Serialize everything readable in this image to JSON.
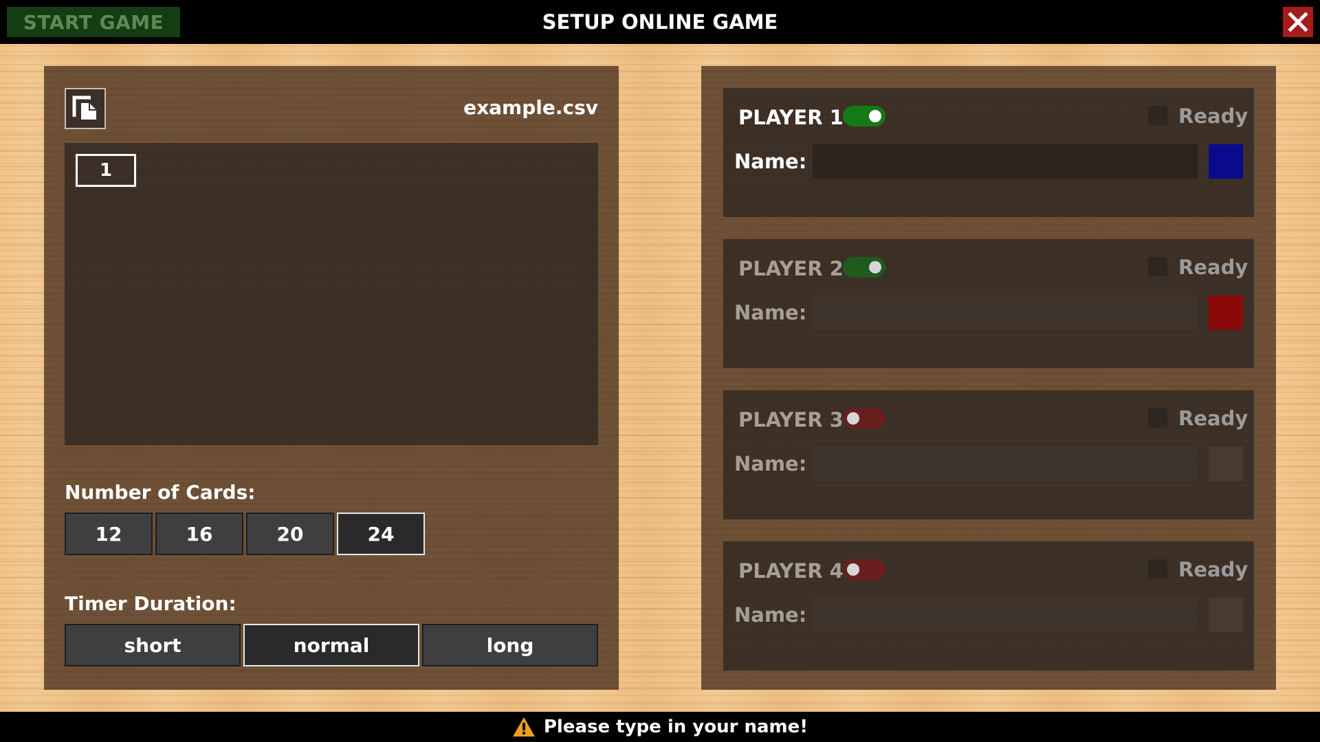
{
  "header": {
    "start_label": "START GAME",
    "title": "SETUP ONLINE GAME",
    "close_icon": "close-icon"
  },
  "deck": {
    "file_name": "example.csv",
    "file_icon": "file-open-icon",
    "tags": [
      "1"
    ]
  },
  "cards": {
    "label": "Number of Cards:",
    "options": [
      "12",
      "16",
      "20",
      "24"
    ],
    "selected": "24"
  },
  "timer": {
    "label": "Timer Duration:",
    "options": [
      "short",
      "normal",
      "long"
    ],
    "selected": "normal"
  },
  "players": [
    {
      "title": "PLAYER 1",
      "enabled": true,
      "active": true,
      "ready_label": "Ready",
      "name_label": "Name:",
      "name_value": "",
      "color": "#0a0a8f",
      "toggle_color": "#157a15"
    },
    {
      "title": "PLAYER 2",
      "enabled": true,
      "active": false,
      "ready_label": "Ready",
      "name_label": "Name:",
      "name_value": "",
      "color": "#8a0a0a",
      "toggle_color": "#1f5a1f"
    },
    {
      "title": "PLAYER 3",
      "enabled": false,
      "active": false,
      "ready_label": "Ready",
      "name_label": "Name:",
      "name_value": "",
      "color": "#463a31",
      "toggle_color": "#6a1f1f"
    },
    {
      "title": "PLAYER 4",
      "enabled": false,
      "active": false,
      "ready_label": "Ready",
      "name_label": "Name:",
      "name_value": "",
      "color": "#463a31",
      "toggle_color": "#6a1f1f"
    }
  ],
  "status": {
    "icon": "warning-icon",
    "message": "Please type in your name!"
  }
}
